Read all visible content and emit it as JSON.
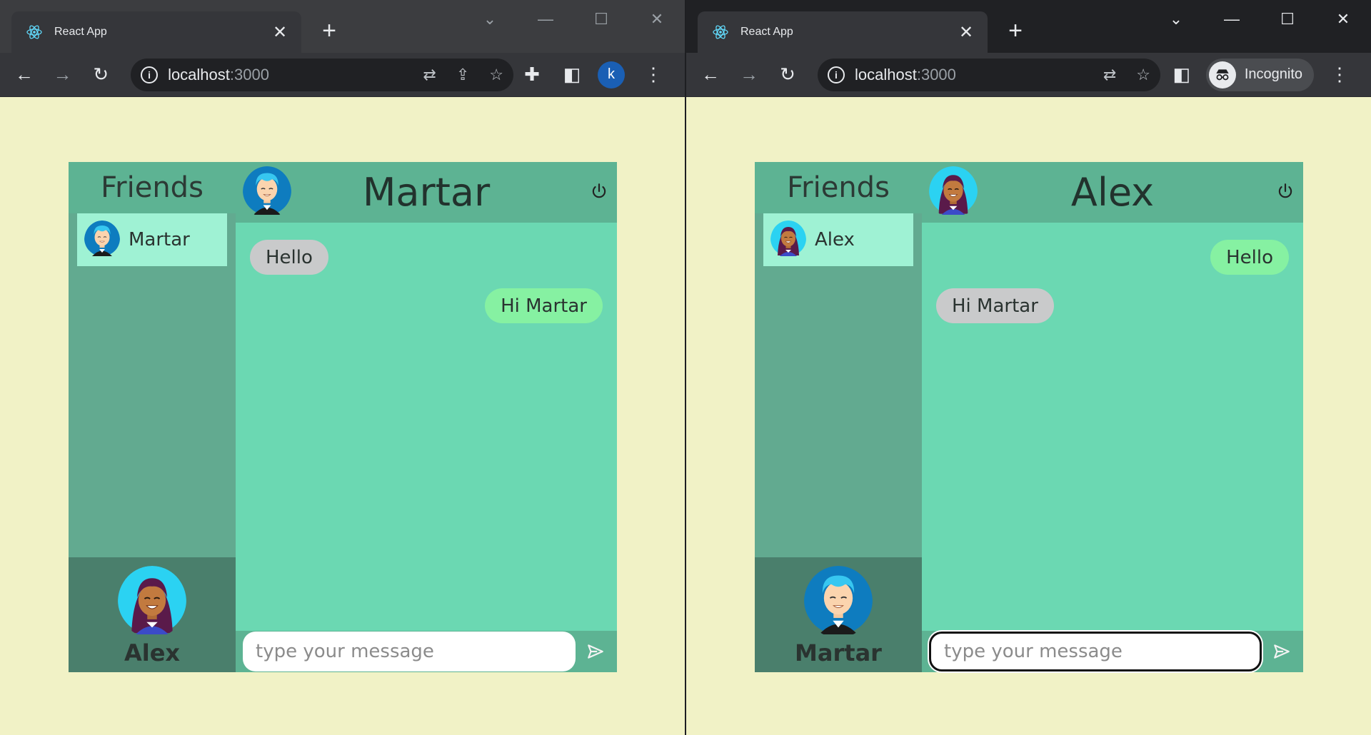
{
  "windows": {
    "left": {
      "tab_title": "React App",
      "url_host": "localhost",
      "url_port": ":3000",
      "profile_initial": "k",
      "chat": {
        "friends_heading": "Friends",
        "friends": [
          {
            "name": "Martar",
            "avatar": "martar-avatar-icon"
          }
        ],
        "partner_name": "Martar",
        "me_name": "Alex",
        "messages": [
          {
            "text": "Hello",
            "direction": "incoming"
          },
          {
            "text": "Hi Martar",
            "direction": "outgoing"
          }
        ],
        "input_placeholder": "type your message"
      }
    },
    "right": {
      "tab_title": "React App",
      "url_host": "localhost",
      "url_port": ":3000",
      "incognito_label": "Incognito",
      "chat": {
        "friends_heading": "Friends",
        "friends": [
          {
            "name": "Alex",
            "avatar": "alex-avatar-icon"
          }
        ],
        "partner_name": "Alex",
        "me_name": "Martar",
        "messages": [
          {
            "text": "Hello",
            "direction": "outgoing"
          },
          {
            "text": "Hi Martar",
            "direction": "incoming"
          }
        ],
        "input_placeholder": "type your message"
      }
    }
  },
  "colors": {
    "page_bg": "#f1f2c6",
    "header_bg": "#5db393",
    "chat_bg": "#6bd8b2",
    "friends_bg": "#62aa90",
    "friend_selected_bg": "#9ff2d4",
    "me_bg": "#4a7f6c",
    "bubble_incoming": "#c9cacb",
    "bubble_outgoing": "#86f1a2"
  }
}
